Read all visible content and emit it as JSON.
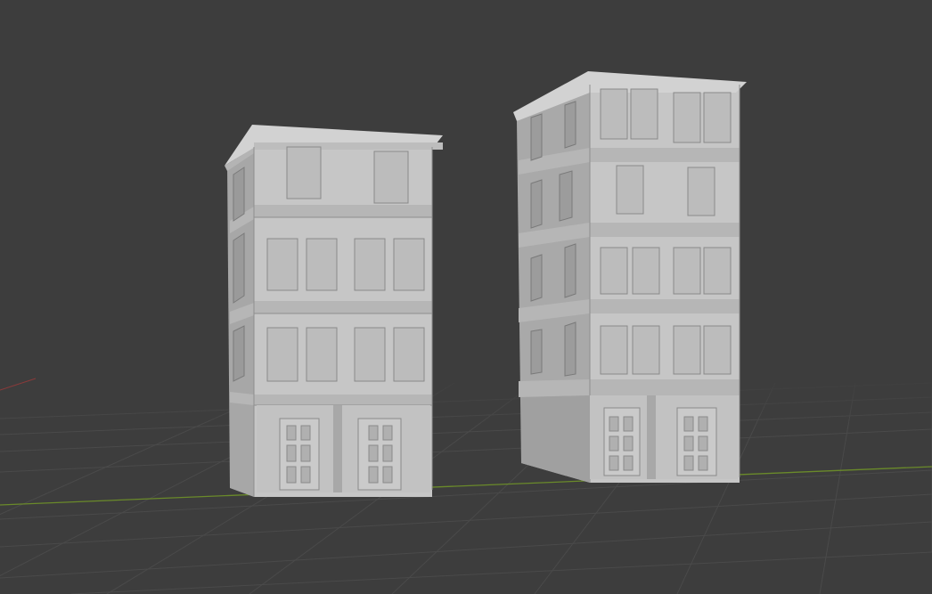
{
  "viewport": {
    "background_color": "#3d3d3d",
    "grid_color": "#4a4a4a",
    "x_axis_color": "#8a3a3a",
    "y_axis_color": "#6a8a2a"
  },
  "scene": {
    "objects": [
      {
        "name": "building-short",
        "floors": 3,
        "has_ground_floor_doors": true,
        "door_count": 2
      },
      {
        "name": "building-tall",
        "floors": 4,
        "has_ground_floor_doors": true,
        "door_count": 2
      }
    ],
    "material_color": "#c8c8c8",
    "shade_color": "#9e9e9e"
  }
}
